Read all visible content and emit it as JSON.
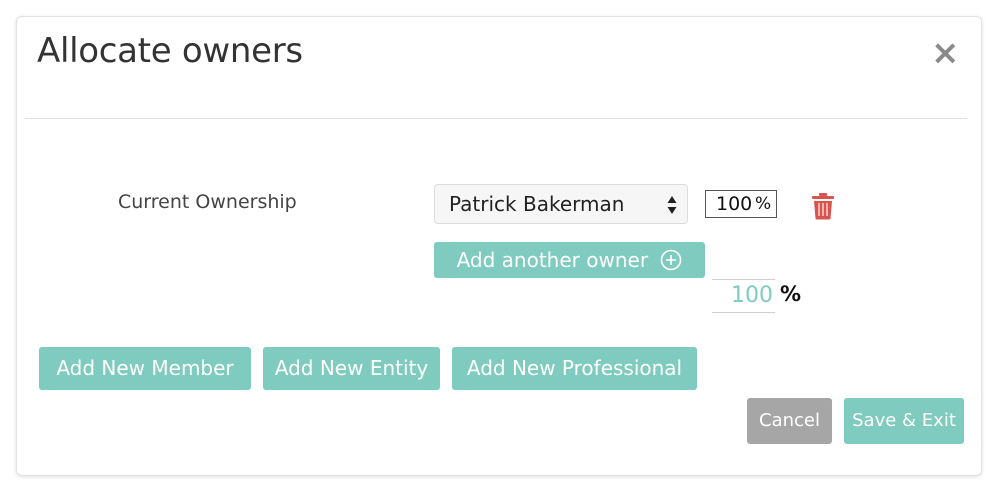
{
  "dialog": {
    "title": "Allocate owners",
    "close_symbol": "×"
  },
  "ownership": {
    "label": "Current Ownership",
    "selected_owner": "Patrick Bakerman",
    "percentage": "100",
    "percent_symbol": "%",
    "add_owner_label": "Add another owner",
    "total_value": "100",
    "total_symbol": "%"
  },
  "actions": {
    "add_member": "Add New Member",
    "add_entity": "Add New Entity",
    "add_professional": "Add New Professional",
    "cancel": "Cancel",
    "save_exit": "Save & Exit"
  },
  "icons": {
    "close": "close-icon",
    "select_arrows": "sort-arrows-icon",
    "trash": "trash-icon",
    "plus": "plus-circle-icon"
  },
  "colors": {
    "accent": "#7fcbbf",
    "cancel": "#a6a6a6",
    "danger": "#d9534f",
    "title": "#333333"
  }
}
